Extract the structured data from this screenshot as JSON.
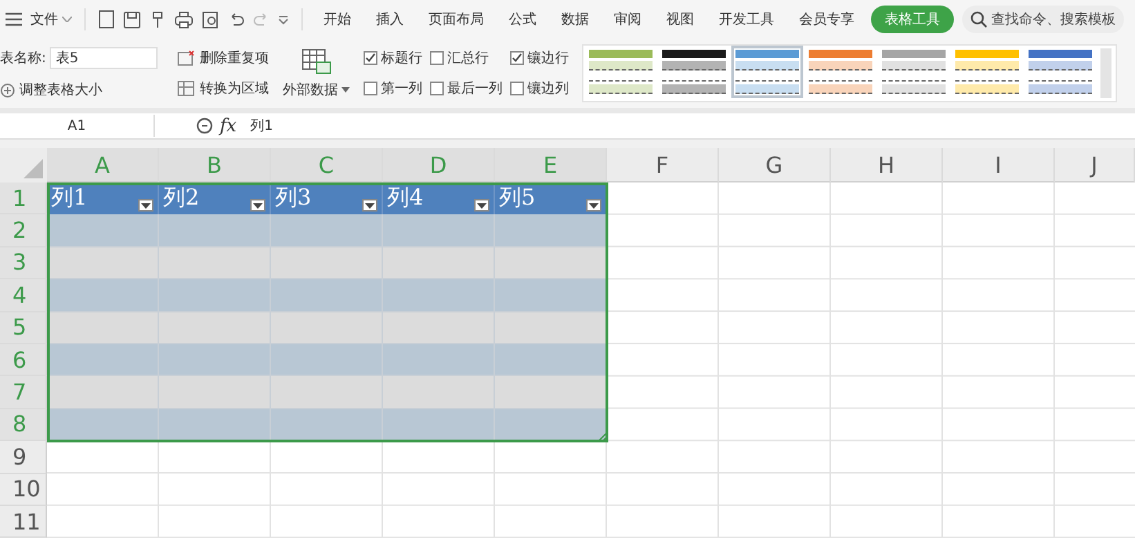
{
  "menu": {
    "file_label": "文件"
  },
  "tabs": [
    {
      "label": "开始",
      "selected": false
    },
    {
      "label": "插入",
      "selected": false
    },
    {
      "label": "页面布局",
      "selected": false
    },
    {
      "label": "公式",
      "selected": false
    },
    {
      "label": "数据",
      "selected": false
    },
    {
      "label": "审阅",
      "selected": false
    },
    {
      "label": "视图",
      "selected": false
    },
    {
      "label": "开发工具",
      "selected": false
    },
    {
      "label": "会员专享",
      "selected": false
    },
    {
      "label": "表格工具",
      "selected": true
    }
  ],
  "search": {
    "placeholder": "查找命令、搜索模板"
  },
  "ribbon": {
    "table_name_label": "表名称:",
    "table_name_value": "表5",
    "resize_label": "调整表格大小",
    "remove_duplicates": "删除重复项",
    "convert_to_range": "转换为区域",
    "external_data": "外部数据",
    "options": [
      {
        "label": "标题行",
        "checked": true
      },
      {
        "label": "汇总行",
        "checked": false
      },
      {
        "label": "镶边行",
        "checked": true
      },
      {
        "label": "第一列",
        "checked": false
      },
      {
        "label": "最后一列",
        "checked": false
      },
      {
        "label": "镶边列",
        "checked": false
      }
    ],
    "styles": [
      {
        "color": "#9bbb59",
        "selected": false
      },
      {
        "color": "#1a1a1a",
        "selected": false
      },
      {
        "color": "#5b9bd5",
        "selected": true
      },
      {
        "color": "#ed7d31",
        "selected": false
      },
      {
        "color": "#a5a5a5",
        "selected": false
      },
      {
        "color": "#ffc000",
        "selected": false
      },
      {
        "color": "#4472c4",
        "selected": false
      }
    ]
  },
  "formula_bar": {
    "cell_ref": "A1",
    "formula": "列1",
    "fx_label": "fx"
  },
  "sheet": {
    "columns": [
      {
        "label": "A",
        "selected": true
      },
      {
        "label": "B",
        "selected": true
      },
      {
        "label": "C",
        "selected": true
      },
      {
        "label": "D",
        "selected": true
      },
      {
        "label": "E",
        "selected": true
      },
      {
        "label": "F",
        "selected": false
      },
      {
        "label": "G",
        "selected": false
      },
      {
        "label": "H",
        "selected": false
      },
      {
        "label": "I",
        "selected": false
      },
      {
        "label": "J",
        "selected": false
      }
    ],
    "rows": [
      {
        "label": "1",
        "selected": true
      },
      {
        "label": "2",
        "selected": true
      },
      {
        "label": "3",
        "selected": true
      },
      {
        "label": "4",
        "selected": true
      },
      {
        "label": "5",
        "selected": true
      },
      {
        "label": "6",
        "selected": true
      },
      {
        "label": "7",
        "selected": true
      },
      {
        "label": "8",
        "selected": true
      },
      {
        "label": "9",
        "selected": false
      },
      {
        "label": "10",
        "selected": false
      },
      {
        "label": "11",
        "selected": false
      }
    ],
    "table": {
      "headers": [
        "列1",
        "列2",
        "列3",
        "列4",
        "列5"
      ],
      "rows": [
        {
          "kind": "shaded"
        },
        {
          "kind": "plain"
        },
        {
          "kind": "shaded"
        },
        {
          "kind": "plain"
        },
        {
          "kind": "shaded"
        },
        {
          "kind": "plain"
        },
        {
          "kind": "shaded"
        }
      ]
    }
  }
}
